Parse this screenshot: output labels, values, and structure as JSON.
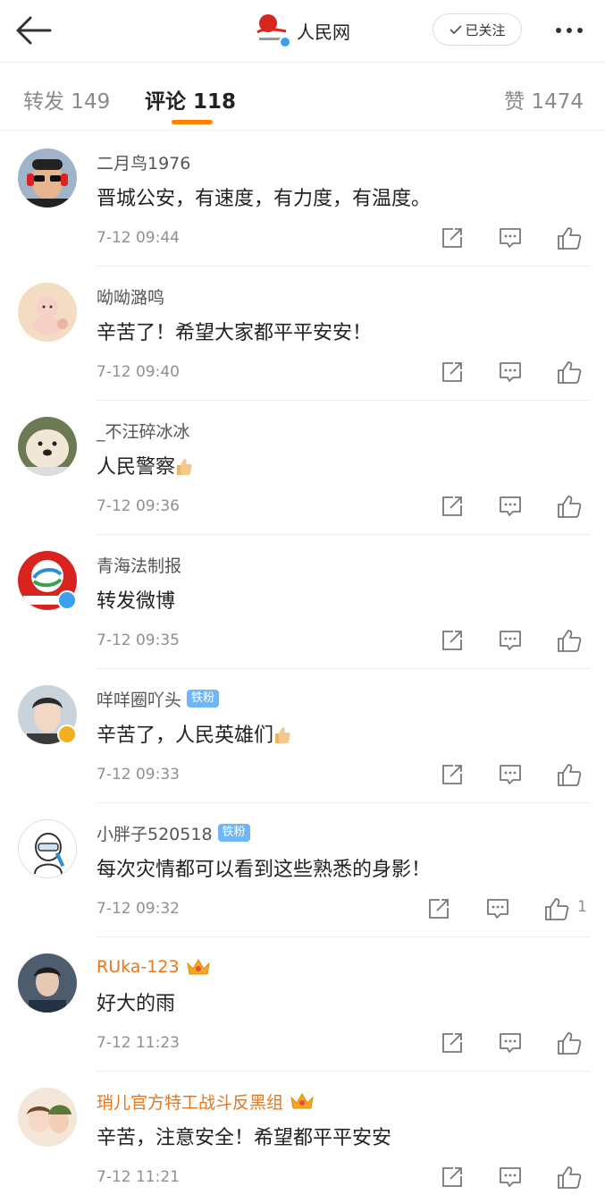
{
  "header": {
    "account_name": "人民网",
    "follow_label": "已关注"
  },
  "tabs": {
    "repost": "转发 149",
    "comment": "评论 118",
    "like": "赞 1474"
  },
  "comments": [
    {
      "username": "二月鸟1976",
      "text": "晋城公安，有速度，有力度，有温度。",
      "time": "7-12 09:44"
    },
    {
      "username": "呦呦潞鸣",
      "text": "辛苦了！希望大家都平平安安！",
      "time": "7-12 09:40"
    },
    {
      "username": "_不汪碎冰冰",
      "text": "人民警察",
      "time": "7-12 09:36"
    },
    {
      "username": "青海法制报",
      "text": "转发微博",
      "time": "7-12 09:35"
    },
    {
      "username": "咩咩圈吖头",
      "badge": "铁粉",
      "text": "辛苦了，人民英雄们",
      "time": "7-12 09:33"
    },
    {
      "username": "小胖子520518",
      "badge": "铁粉",
      "text": "每次灾情都可以看到这些熟悉的身影！",
      "time": "7-12 09:32",
      "likes": "1"
    },
    {
      "username": "RUka-123",
      "text": "好大的雨",
      "time": "7-12 11:23"
    },
    {
      "username": "琑儿官方特工战斗反黑组",
      "text": "辛苦，注意安全！希望都平平安安",
      "time": "7-12 11:21"
    }
  ],
  "colors": {
    "accent": "#ff8200",
    "vip_name": "#e8761c",
    "fan_badge": "#6fb6f6",
    "verified_blue": "#3aa0f0",
    "verified_gold": "#f2b01e"
  },
  "icons": [
    "back-arrow-icon",
    "check-icon",
    "more-icon",
    "share-icon",
    "comment-icon",
    "thumbs-up-icon",
    "crown-icon"
  ]
}
